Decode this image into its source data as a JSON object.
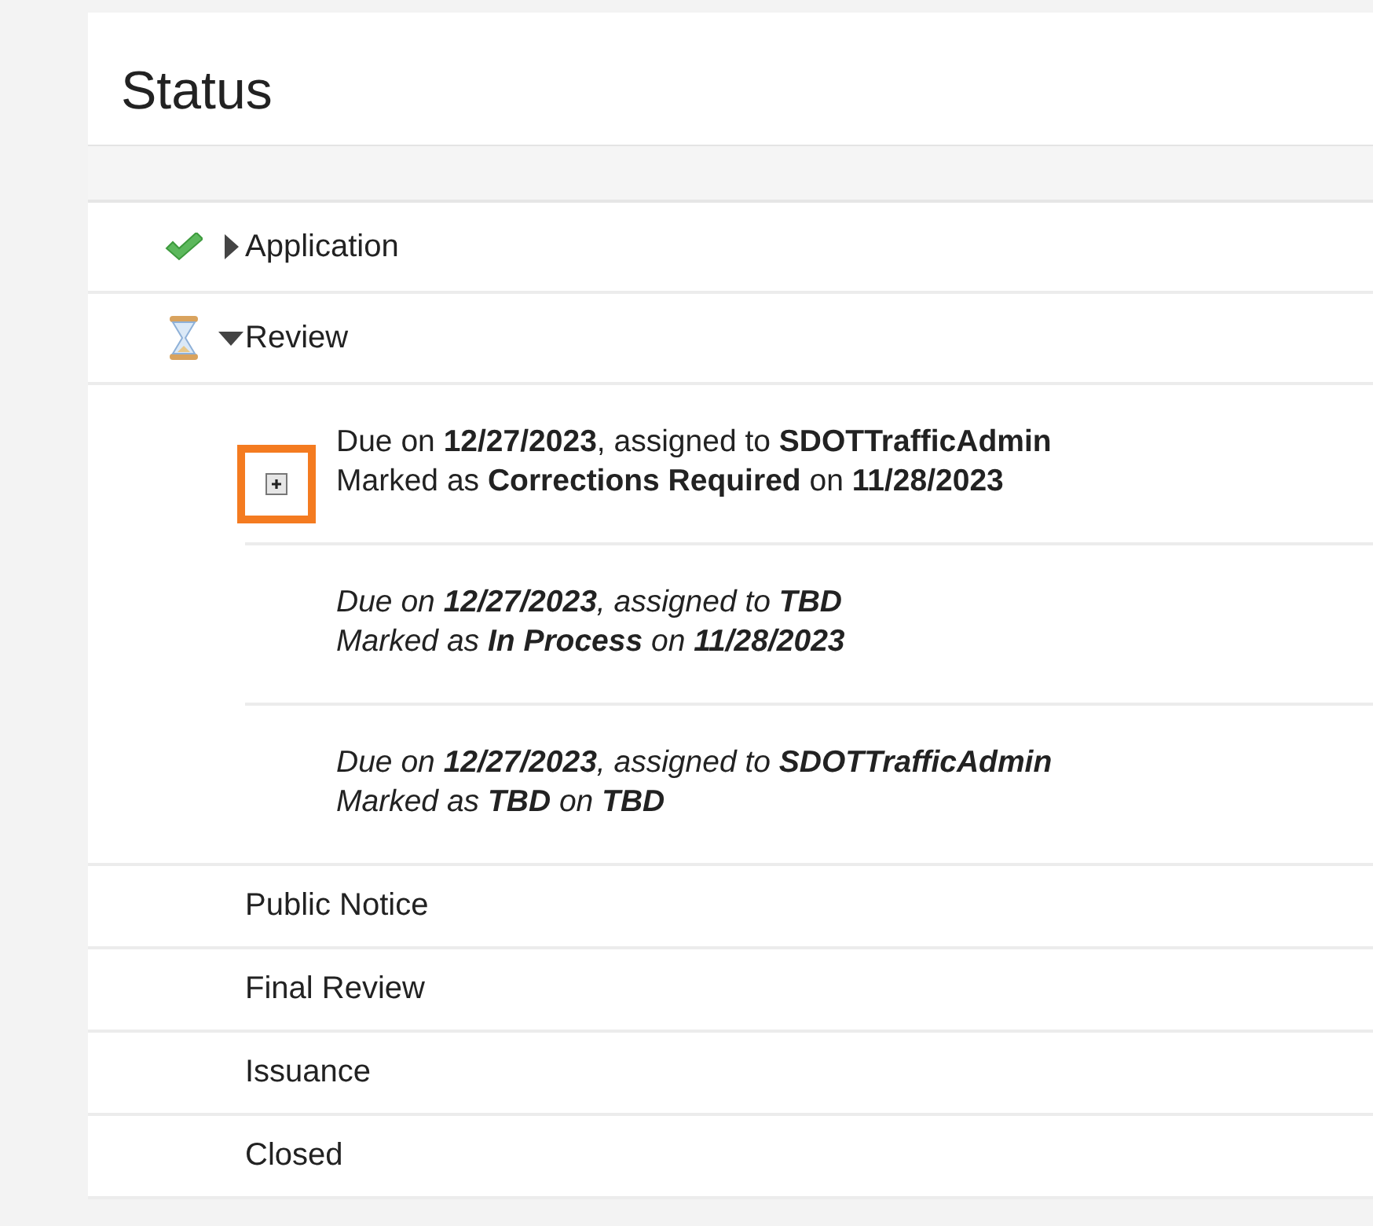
{
  "title": "Status",
  "stages": [
    {
      "label": "Application",
      "kind": "complete",
      "expanded": false
    },
    {
      "label": "Review",
      "kind": "in_progress",
      "expanded": true,
      "tasks": [
        {
          "lines": [
            "Due on **12/27/2023**, assigned to **SDOTTrafficAdmin**",
            "Marked as **Corrections Required** on **11/28/2023**"
          ],
          "active": true,
          "highlighted": true
        },
        {
          "lines": [
            "Due on **12/27/2023**, assigned to **TBD**",
            "Marked as **In Process** on **11/28/2023**"
          ],
          "active": false
        },
        {
          "lines": [
            "Due on **12/27/2023**, assigned to  **SDOTTrafficAdmin**",
            "Marked as **TBD** on **TBD**"
          ],
          "active": false
        }
      ]
    },
    {
      "label": "Public Notice",
      "kind": "pending"
    },
    {
      "label": "Final Review",
      "kind": "pending"
    },
    {
      "label": "Issuance",
      "kind": "pending"
    },
    {
      "label": "Closed",
      "kind": "pending"
    }
  ]
}
